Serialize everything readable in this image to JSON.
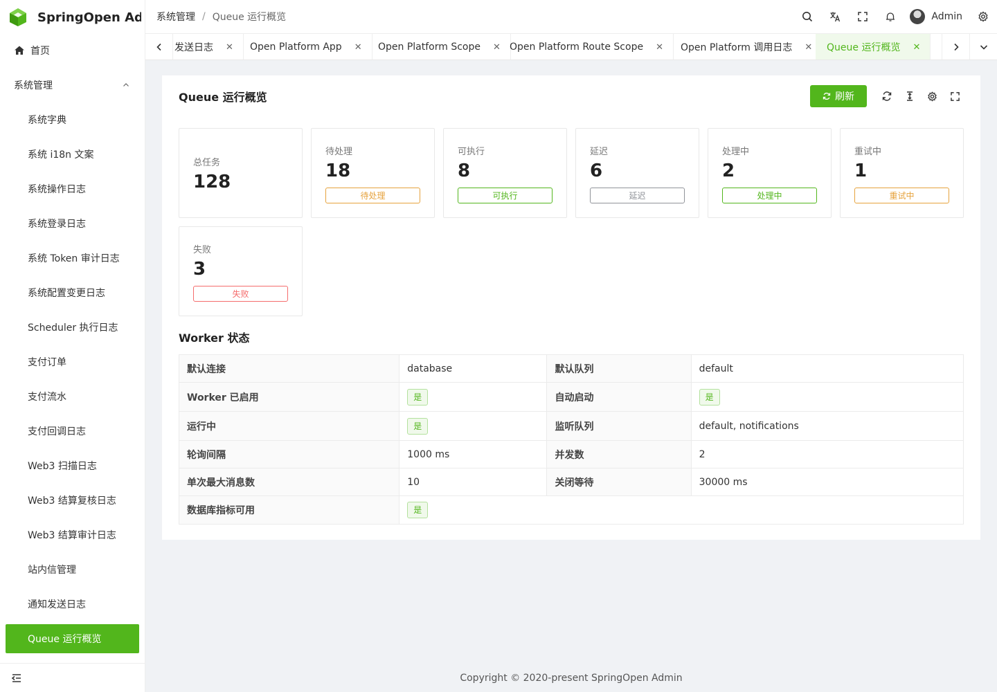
{
  "app": {
    "title": "SpringOpen Ad..."
  },
  "colors": {
    "brand": "#52b61c",
    "pending": "#e6a23c",
    "info": "#909399",
    "danger": "#f56c6c"
  },
  "sidebar": {
    "home": "首页",
    "group": "系统管理",
    "items": [
      "系统字典",
      "系统 i18n 文案",
      "系统操作日志",
      "系统登录日志",
      "系统 Token 审计日志",
      "系统配置变更日志",
      "Scheduler 执行日志",
      "支付订单",
      "支付流水",
      "支付回调日志",
      "Web3 扫描日志",
      "Web3 结算复核日志",
      "Web3 结算审计日志",
      "站内信管理",
      "通知发送日志"
    ],
    "active": "Queue 运行概览"
  },
  "header": {
    "breadcrumb": [
      "系统管理",
      "Queue 运行概览"
    ],
    "separator": "/",
    "user": "Admin"
  },
  "tabs": [
    {
      "label": "发送日志",
      "active": false
    },
    {
      "label": "Open Platform App",
      "active": false
    },
    {
      "label": "Open Platform Scope",
      "active": false
    },
    {
      "label": "Open Platform Route Scope",
      "active": false
    },
    {
      "label": "Open Platform 调用日志",
      "active": false
    },
    {
      "label": "Queue 运行概览",
      "active": true
    }
  ],
  "page": {
    "title": "Queue 运行概览",
    "refresh": "刷新",
    "stats": [
      {
        "label": "总任务",
        "value": "128",
        "tag": ""
      },
      {
        "label": "待处理",
        "value": "18",
        "tag": "待处理",
        "color": "#e6a23c"
      },
      {
        "label": "可执行",
        "value": "8",
        "tag": "可执行",
        "color": "#52b61c"
      },
      {
        "label": "延迟",
        "value": "6",
        "tag": "延迟",
        "color": "#909399"
      },
      {
        "label": "处理中",
        "value": "2",
        "tag": "处理中",
        "color": "#52b61c"
      },
      {
        "label": "重试中",
        "value": "1",
        "tag": "重试中",
        "color": "#e6a23c"
      },
      {
        "label": "失败",
        "value": "3",
        "tag": "失败",
        "color": "#f56c6c"
      }
    ],
    "worker_title": "Worker 状态",
    "worker": [
      {
        "l1": "默认连接",
        "v1": "database",
        "l2": "默认队列",
        "v2": "default"
      },
      {
        "l1": "Worker 已启用",
        "v1": "是",
        "l2": "自动启动",
        "v2": "是"
      },
      {
        "l1": "运行中",
        "v1": "是",
        "l2": "监听队列",
        "v2": "default, notifications"
      },
      {
        "l1": "轮询间隔",
        "v1": "1000 ms",
        "l2": "并发数",
        "v2": "2"
      },
      {
        "l1": "单次最大消息数",
        "v1": "10",
        "l2": "关闭等待",
        "v2": "30000 ms"
      },
      {
        "l1": "数据库指标可用",
        "v1": "是"
      }
    ]
  },
  "footer": "Copyright © 2020-present SpringOpen Admin"
}
